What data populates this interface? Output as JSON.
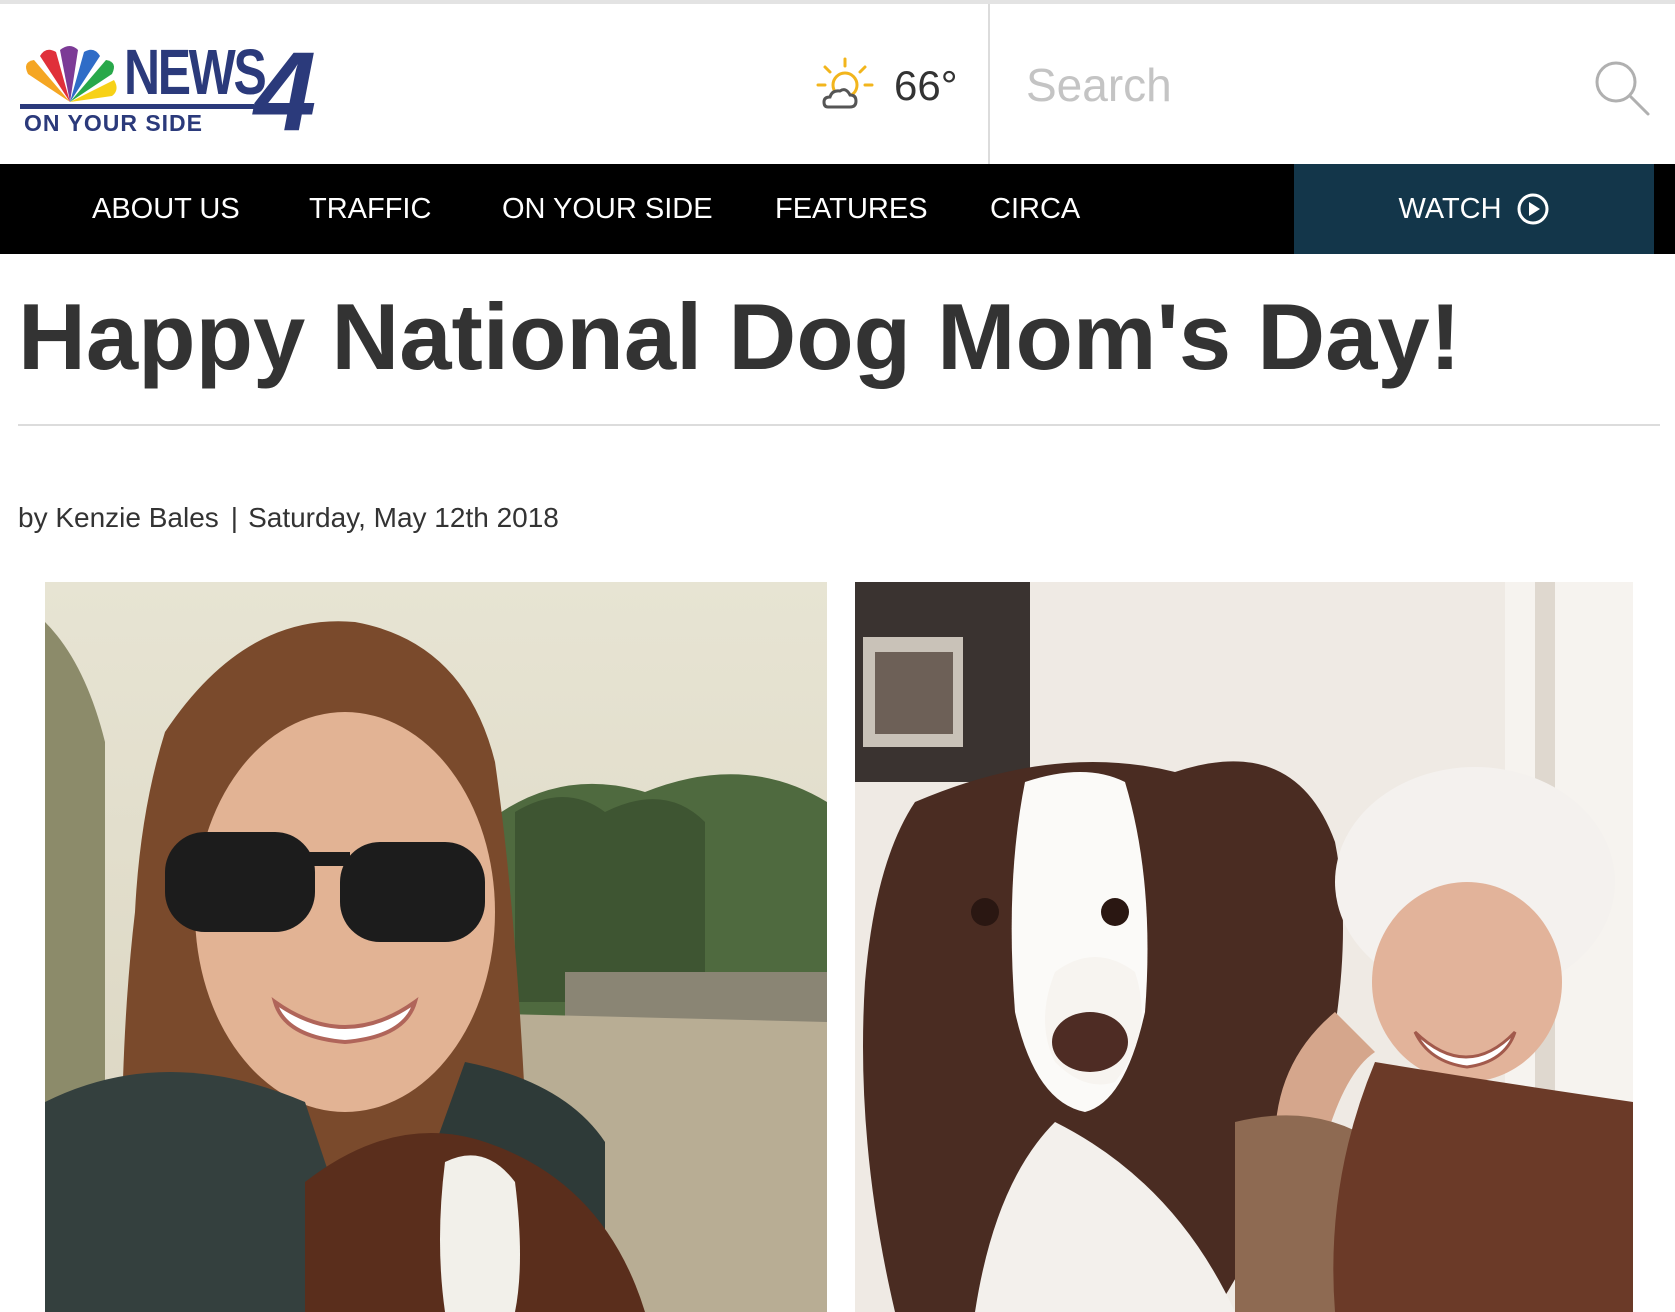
{
  "brand": {
    "name": "NEWS",
    "number": "4",
    "tagline": "ON YOUR SIDE",
    "logo_colors": [
      "#f5a623",
      "#e0303a",
      "#7c3b96",
      "#2f6cc7",
      "#28a84a",
      "#f7d117"
    ]
  },
  "weather": {
    "icon": "partly-sunny-icon",
    "temperature": "66°"
  },
  "search": {
    "placeholder": "Search",
    "icon": "search-icon"
  },
  "nav": {
    "items": [
      "ABOUT US",
      "TRAFFIC",
      "ON YOUR SIDE",
      "FEATURES",
      "CIRCA"
    ],
    "watch_label": "WATCH",
    "watch_icon": "play-circle-icon",
    "background": "#000000",
    "watch_background": "#13364a"
  },
  "article": {
    "title": "Happy National Dog Mom's Day!",
    "author": "by Kenzie Bales",
    "separator": "|",
    "date": "Saturday, May 12th 2018",
    "photos": [
      {
        "description_icon": "woman-with-sunglasses-and-puppy-photo"
      },
      {
        "description_icon": "woman-in-white-hat-with-border-collie-photo"
      }
    ]
  }
}
